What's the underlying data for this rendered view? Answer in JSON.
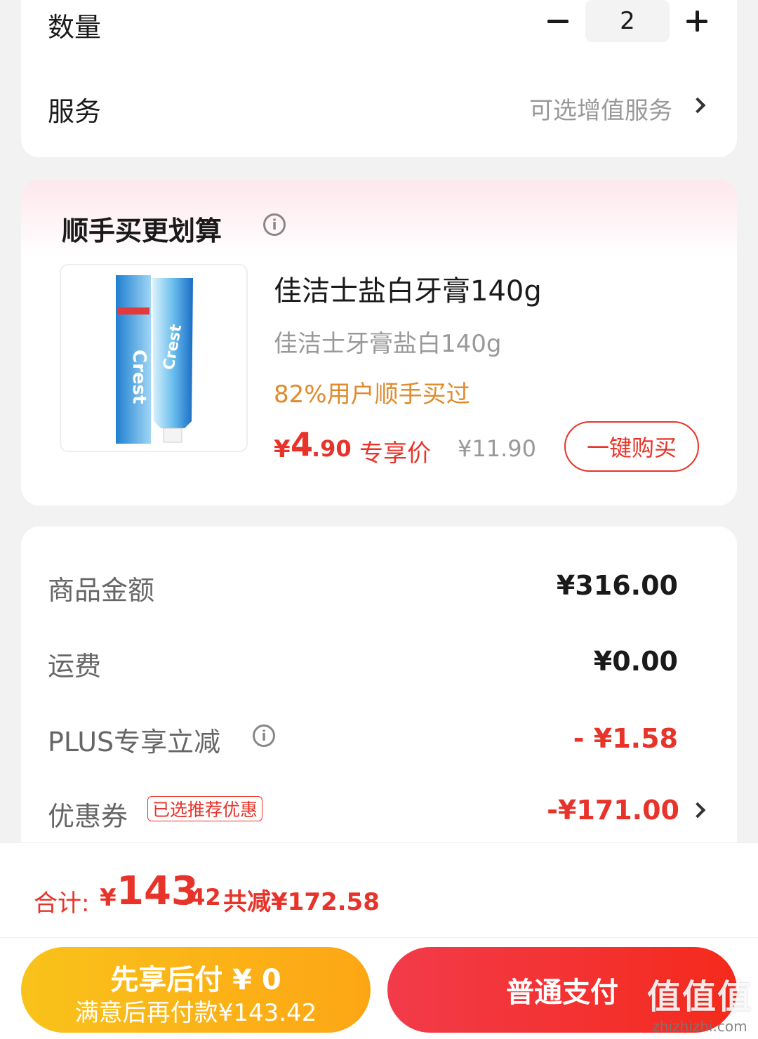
{
  "order_options": {
    "quantity_label": "数量",
    "quantity_value": "2",
    "service_label": "服务",
    "service_hint": "可选增值服务"
  },
  "recommend": {
    "title": "顺手买更划算",
    "product": {
      "name": "佳洁士盐白牙膏140g",
      "subtitle": "佳洁士牙膏盐白140g",
      "stat": "82%用户顺手买过",
      "price_symbol": "¥",
      "price_int": "4",
      "price_dec": ".90",
      "price_tag": "专享价",
      "original_price": "¥11.90",
      "buy_label": "一键购买"
    }
  },
  "summary": {
    "rows": [
      {
        "label": "商品金额",
        "value": "¥316.00"
      },
      {
        "label": "运费",
        "value": "¥0.00"
      },
      {
        "label": "PLUS专享立减",
        "value": "- ¥1.58"
      },
      {
        "label": "优惠券",
        "value": "-¥171.00"
      }
    ],
    "coupon_tag": "已选推荐优惠"
  },
  "bottom": {
    "total_label": "合计:",
    "total_symbol": "¥",
    "total_int": "143",
    "total_dec": ".42",
    "total_saved": "共减¥172.58",
    "pay_later_line1": "先享后付 ¥ 0",
    "pay_later_line2": "满意后再付款¥143.42",
    "pay_now_label": "普通支付"
  },
  "watermark": {
    "mark": "值值值",
    "site": "zhizhizhi.com"
  },
  "colors": {
    "accent_red": "#e8332a",
    "stat_orange": "#e08a2c",
    "pay_later_yellow": "#f9c21b",
    "pay_now_red": "#f23b4a"
  }
}
